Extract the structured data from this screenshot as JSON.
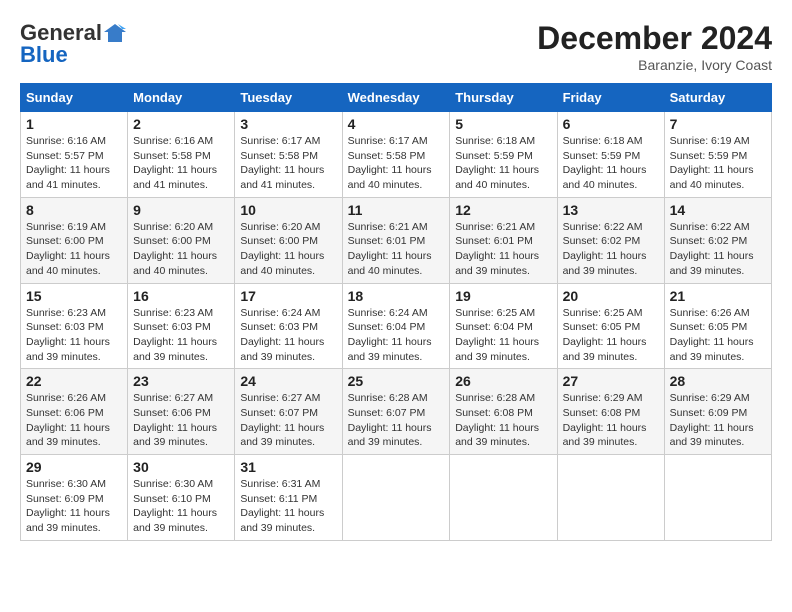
{
  "header": {
    "logo_general": "General",
    "logo_blue": "Blue",
    "month_title": "December 2024",
    "location": "Baranzie, Ivory Coast"
  },
  "calendar": {
    "days_of_week": [
      "Sunday",
      "Monday",
      "Tuesday",
      "Wednesday",
      "Thursday",
      "Friday",
      "Saturday"
    ],
    "weeks": [
      [
        {
          "day": "1",
          "sunrise": "6:16 AM",
          "sunset": "5:57 PM",
          "daylight": "11 hours and 41 minutes."
        },
        {
          "day": "2",
          "sunrise": "6:16 AM",
          "sunset": "5:58 PM",
          "daylight": "11 hours and 41 minutes."
        },
        {
          "day": "3",
          "sunrise": "6:17 AM",
          "sunset": "5:58 PM",
          "daylight": "11 hours and 41 minutes."
        },
        {
          "day": "4",
          "sunrise": "6:17 AM",
          "sunset": "5:58 PM",
          "daylight": "11 hours and 40 minutes."
        },
        {
          "day": "5",
          "sunrise": "6:18 AM",
          "sunset": "5:59 PM",
          "daylight": "11 hours and 40 minutes."
        },
        {
          "day": "6",
          "sunrise": "6:18 AM",
          "sunset": "5:59 PM",
          "daylight": "11 hours and 40 minutes."
        },
        {
          "day": "7",
          "sunrise": "6:19 AM",
          "sunset": "5:59 PM",
          "daylight": "11 hours and 40 minutes."
        }
      ],
      [
        {
          "day": "8",
          "sunrise": "6:19 AM",
          "sunset": "6:00 PM",
          "daylight": "11 hours and 40 minutes."
        },
        {
          "day": "9",
          "sunrise": "6:20 AM",
          "sunset": "6:00 PM",
          "daylight": "11 hours and 40 minutes."
        },
        {
          "day": "10",
          "sunrise": "6:20 AM",
          "sunset": "6:00 PM",
          "daylight": "11 hours and 40 minutes."
        },
        {
          "day": "11",
          "sunrise": "6:21 AM",
          "sunset": "6:01 PM",
          "daylight": "11 hours and 40 minutes."
        },
        {
          "day": "12",
          "sunrise": "6:21 AM",
          "sunset": "6:01 PM",
          "daylight": "11 hours and 39 minutes."
        },
        {
          "day": "13",
          "sunrise": "6:22 AM",
          "sunset": "6:02 PM",
          "daylight": "11 hours and 39 minutes."
        },
        {
          "day": "14",
          "sunrise": "6:22 AM",
          "sunset": "6:02 PM",
          "daylight": "11 hours and 39 minutes."
        }
      ],
      [
        {
          "day": "15",
          "sunrise": "6:23 AM",
          "sunset": "6:03 PM",
          "daylight": "11 hours and 39 minutes."
        },
        {
          "day": "16",
          "sunrise": "6:23 AM",
          "sunset": "6:03 PM",
          "daylight": "11 hours and 39 minutes."
        },
        {
          "day": "17",
          "sunrise": "6:24 AM",
          "sunset": "6:03 PM",
          "daylight": "11 hours and 39 minutes."
        },
        {
          "day": "18",
          "sunrise": "6:24 AM",
          "sunset": "6:04 PM",
          "daylight": "11 hours and 39 minutes."
        },
        {
          "day": "19",
          "sunrise": "6:25 AM",
          "sunset": "6:04 PM",
          "daylight": "11 hours and 39 minutes."
        },
        {
          "day": "20",
          "sunrise": "6:25 AM",
          "sunset": "6:05 PM",
          "daylight": "11 hours and 39 minutes."
        },
        {
          "day": "21",
          "sunrise": "6:26 AM",
          "sunset": "6:05 PM",
          "daylight": "11 hours and 39 minutes."
        }
      ],
      [
        {
          "day": "22",
          "sunrise": "6:26 AM",
          "sunset": "6:06 PM",
          "daylight": "11 hours and 39 minutes."
        },
        {
          "day": "23",
          "sunrise": "6:27 AM",
          "sunset": "6:06 PM",
          "daylight": "11 hours and 39 minutes."
        },
        {
          "day": "24",
          "sunrise": "6:27 AM",
          "sunset": "6:07 PM",
          "daylight": "11 hours and 39 minutes."
        },
        {
          "day": "25",
          "sunrise": "6:28 AM",
          "sunset": "6:07 PM",
          "daylight": "11 hours and 39 minutes."
        },
        {
          "day": "26",
          "sunrise": "6:28 AM",
          "sunset": "6:08 PM",
          "daylight": "11 hours and 39 minutes."
        },
        {
          "day": "27",
          "sunrise": "6:29 AM",
          "sunset": "6:08 PM",
          "daylight": "11 hours and 39 minutes."
        },
        {
          "day": "28",
          "sunrise": "6:29 AM",
          "sunset": "6:09 PM",
          "daylight": "11 hours and 39 minutes."
        }
      ],
      [
        {
          "day": "29",
          "sunrise": "6:30 AM",
          "sunset": "6:09 PM",
          "daylight": "11 hours and 39 minutes."
        },
        {
          "day": "30",
          "sunrise": "6:30 AM",
          "sunset": "6:10 PM",
          "daylight": "11 hours and 39 minutes."
        },
        {
          "day": "31",
          "sunrise": "6:31 AM",
          "sunset": "6:11 PM",
          "daylight": "11 hours and 39 minutes."
        },
        null,
        null,
        null,
        null
      ]
    ],
    "labels": {
      "sunrise": "Sunrise:",
      "sunset": "Sunset:",
      "daylight": "Daylight:"
    }
  }
}
